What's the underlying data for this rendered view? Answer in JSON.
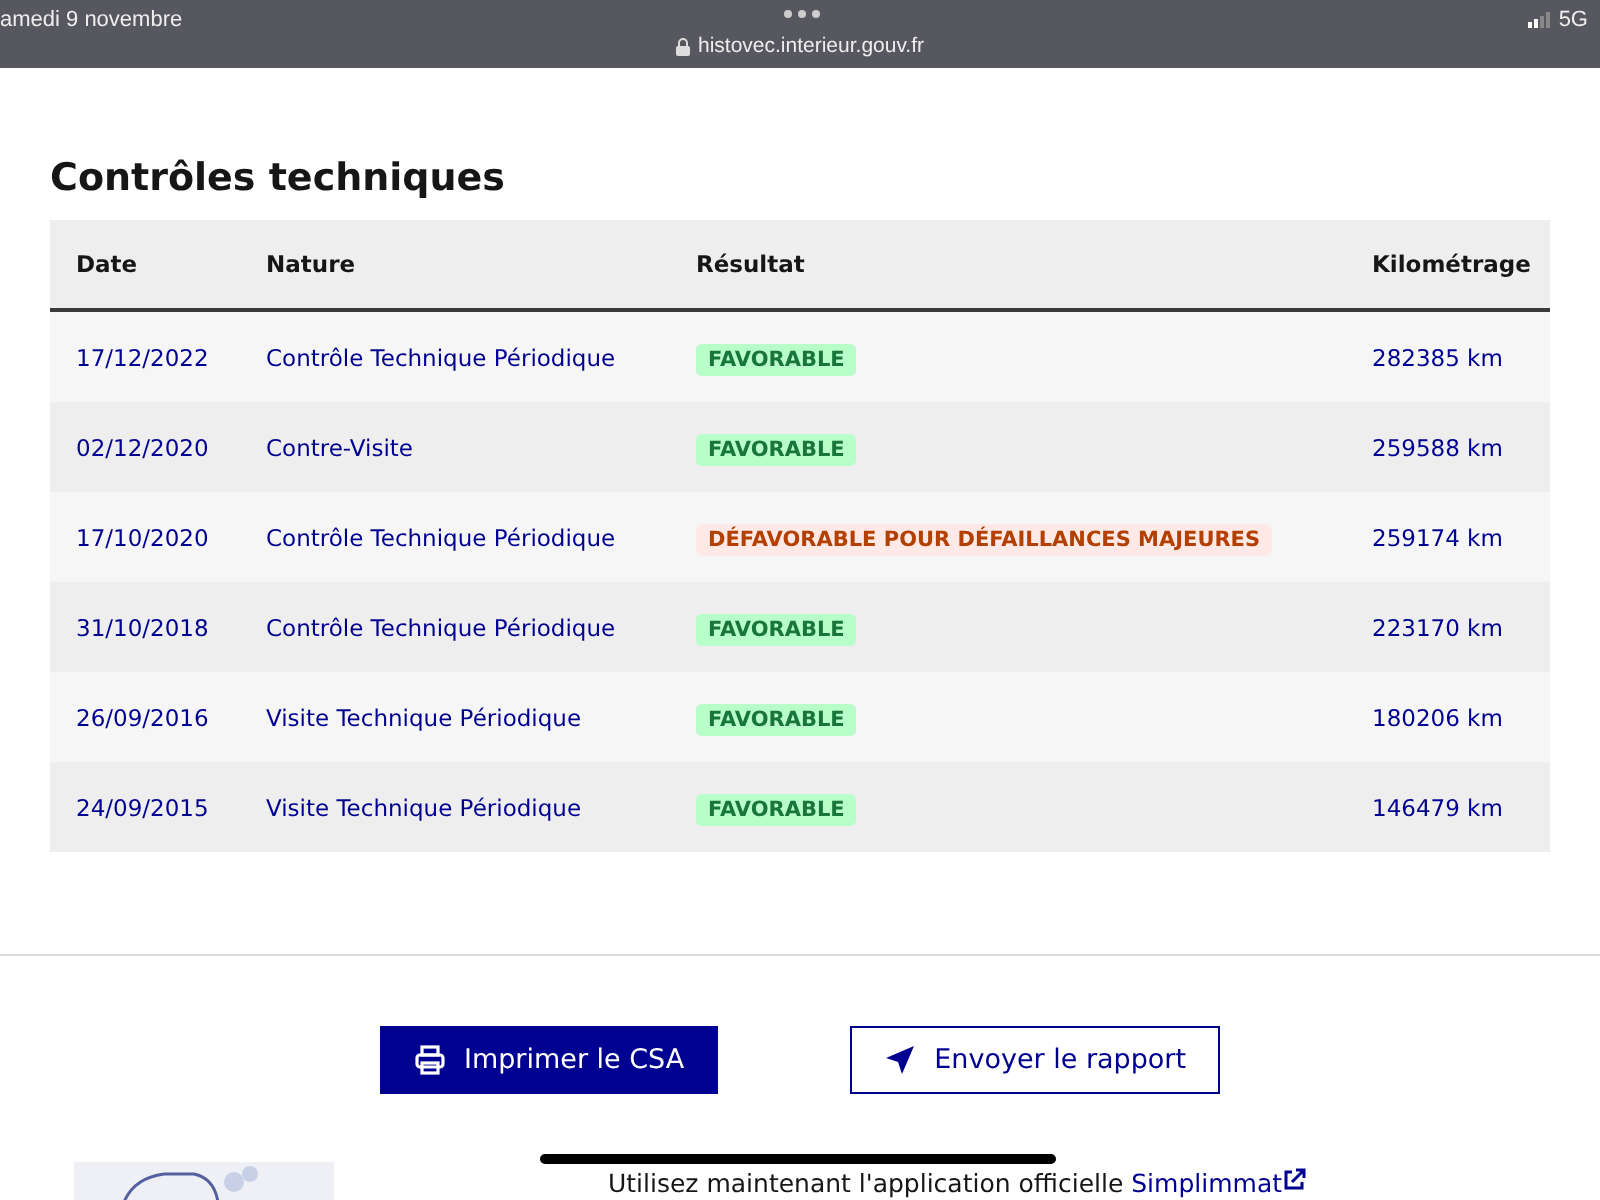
{
  "status_bar": {
    "date": "amedi 9 novembre",
    "url": "histovec.interieur.gouv.fr",
    "network": "5G"
  },
  "section": {
    "title": "Contrôles techniques",
    "columns": [
      "Date",
      "Nature",
      "Résultat",
      "Kilométrage"
    ],
    "rows": [
      {
        "date": "17/12/2022",
        "nature": "Contrôle Technique Périodique",
        "result": {
          "kind": "favorable",
          "label": "FAVORABLE"
        },
        "km": "282385 km"
      },
      {
        "date": "02/12/2020",
        "nature": "Contre-Visite",
        "result": {
          "kind": "favorable",
          "label": "FAVORABLE"
        },
        "km": "259588 km"
      },
      {
        "date": "17/10/2020",
        "nature": "Contrôle Technique Périodique",
        "result": {
          "kind": "unfavorable",
          "label": "DÉFAVORABLE POUR DÉFAILLANCES MAJEURES"
        },
        "km": "259174 km"
      },
      {
        "date": "31/10/2018",
        "nature": "Contrôle Technique Périodique",
        "result": {
          "kind": "favorable",
          "label": "FAVORABLE"
        },
        "km": "223170 km"
      },
      {
        "date": "26/09/2016",
        "nature": "Visite Technique Périodique",
        "result": {
          "kind": "favorable",
          "label": "FAVORABLE"
        },
        "km": "180206 km"
      },
      {
        "date": "24/09/2015",
        "nature": "Visite Technique Périodique",
        "result": {
          "kind": "favorable",
          "label": "FAVORABLE"
        },
        "km": "146479 km"
      }
    ]
  },
  "buttons": [
    {
      "kind": "primary",
      "label": "Imprimer le CSA"
    },
    {
      "kind": "secondary",
      "label": "Envoyer le rapport"
    }
  ],
  "footer": {
    "text": "Utilisez maintenant l'application officielle",
    "link": "Simplimmat"
  }
}
